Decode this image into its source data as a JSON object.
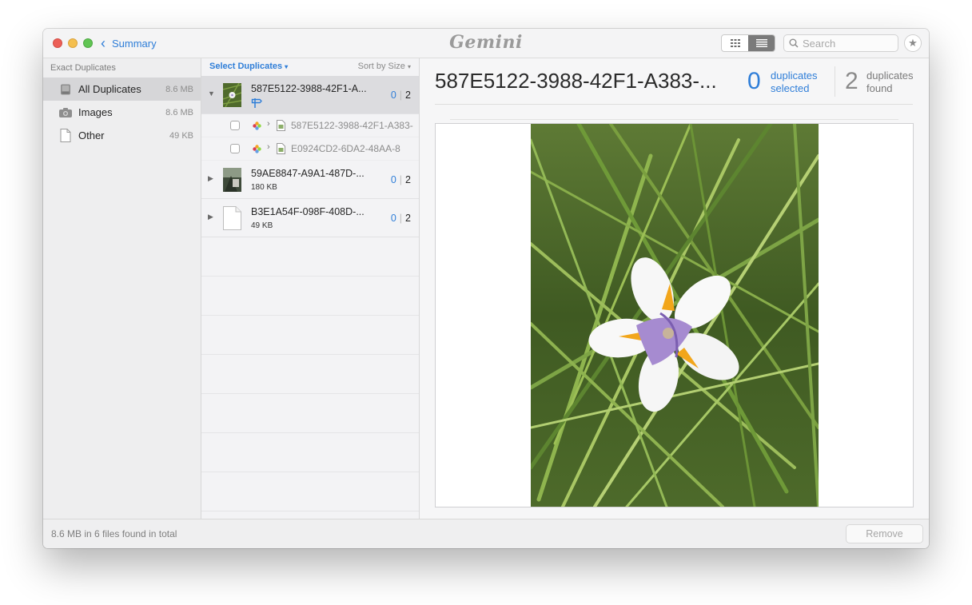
{
  "titlebar": {
    "back_label": "Summary",
    "logo_text": "Gemini",
    "search_placeholder": "Search",
    "view_mode": "list"
  },
  "sidebar": {
    "heading": "Exact Duplicates",
    "items": [
      {
        "label": "All Duplicates",
        "size": "8.6 MB",
        "icon": "drive-icon",
        "selected": true
      },
      {
        "label": "Images",
        "size": "8.6 MB",
        "icon": "camera-icon",
        "selected": false
      },
      {
        "label": "Other",
        "size": "49 KB",
        "icon": "document-icon",
        "selected": false
      }
    ]
  },
  "list": {
    "select_label": "Select Duplicates",
    "sort_label": "Sort by Size",
    "groups": [
      {
        "name": "587E5122-3988-42F1-A...",
        "selected_count": "0",
        "found_count": "2",
        "expanded": true,
        "children": [
          {
            "name": "587E5122-3988-42F1-A383-"
          },
          {
            "name": "E0924CD2-6DA2-48AA-8"
          }
        ]
      },
      {
        "name": "59AE8847-A9A1-487D-...",
        "size": "180 KB",
        "selected_count": "0",
        "found_count": "2",
        "expanded": false
      },
      {
        "name": "B3E1A54F-098F-408D-...",
        "size": "49 KB",
        "selected_count": "0",
        "found_count": "2",
        "expanded": false
      }
    ]
  },
  "detail": {
    "title": "587E5122-3988-42F1-A383-...",
    "selected_count": "0",
    "selected_label_1": "duplicates",
    "selected_label_2": "selected",
    "found_count": "2",
    "found_label_1": "duplicates",
    "found_label_2": "found"
  },
  "footer": {
    "info": "8.6 MB in 6 files found in total",
    "remove_label": "Remove"
  },
  "colors": {
    "accent": "#2f7ed8",
    "sidebar_bg": "#eeeeef",
    "selected_row": "#d6d6d8"
  }
}
